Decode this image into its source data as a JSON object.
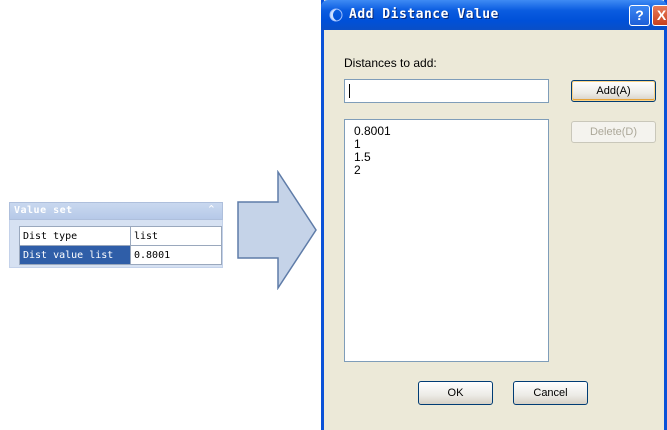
{
  "property_panel": {
    "title": "Value set",
    "rows": [
      {
        "key": "Dist type",
        "value": "list"
      },
      {
        "key": "Dist value list",
        "value": "0.8001"
      }
    ]
  },
  "dialog": {
    "title": "Add Distance Value",
    "help_label": "?",
    "close_label": "X",
    "distances_label": "Distances to add:",
    "input_value": "",
    "add_button": "Add(A)",
    "delete_button": "Delete(D)",
    "list_items": [
      "0.8001",
      "1",
      "1.5",
      "2"
    ],
    "ok_button": "OK",
    "cancel_button": "Cancel"
  },
  "colors": {
    "titlebar_blue": "#0054e3",
    "selected_row": "#2f5ea8",
    "panel_header": "#b6c9e8",
    "dialog_face": "#ece9d8",
    "arrow_fill": "#c5d3e8"
  }
}
